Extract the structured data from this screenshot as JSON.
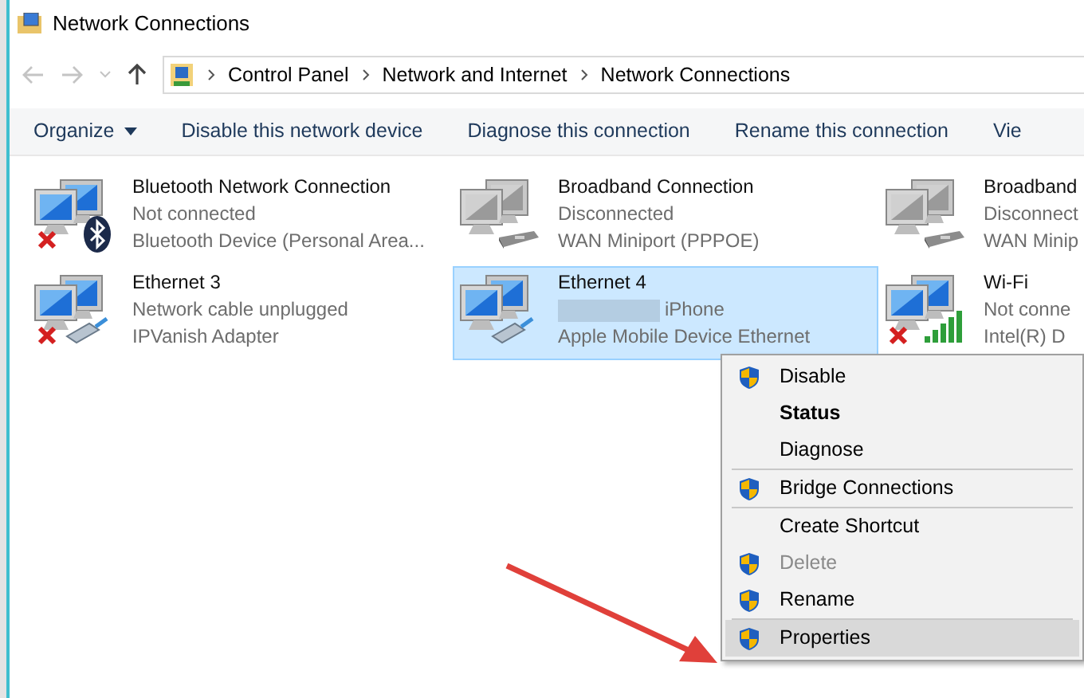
{
  "window": {
    "title": "Network Connections"
  },
  "breadcrumb": [
    "Control Panel",
    "Network and Internet",
    "Network Connections"
  ],
  "toolbar": [
    {
      "label": "Organize",
      "dropdown": true
    },
    {
      "label": "Disable this network device",
      "dropdown": false
    },
    {
      "label": "Diagnose this connection",
      "dropdown": false
    },
    {
      "label": "Rename this connection",
      "dropdown": false
    },
    {
      "label": "Vie",
      "dropdown": false
    }
  ],
  "connections": [
    {
      "name": "Bluetooth Network Connection",
      "status": "Not connected",
      "device": "Bluetooth Device (Personal Area...",
      "kind": "bluetooth",
      "error": true,
      "enabled": true,
      "selected": false,
      "redacted": false
    },
    {
      "name": "Broadband Connection",
      "status": "Disconnected",
      "device": "WAN Miniport (PPPOE)",
      "kind": "modem",
      "error": false,
      "enabled": false,
      "selected": false,
      "redacted": false
    },
    {
      "name": "Broadband",
      "status": "Disconnect",
      "device": "WAN Minip",
      "kind": "modem",
      "error": false,
      "enabled": false,
      "selected": false,
      "redacted": false
    },
    {
      "name": "Ethernet 3",
      "status": "Network cable unplugged",
      "device": "IPVanish Adapter",
      "kind": "cable",
      "error": true,
      "enabled": true,
      "selected": false,
      "redacted": false
    },
    {
      "name": "Ethernet 4",
      "status": "iPhone",
      "device": "Apple Mobile Device Ethernet",
      "kind": "cable",
      "error": false,
      "enabled": true,
      "selected": true,
      "redacted": true
    },
    {
      "name": "Wi-Fi",
      "status": "Not conne",
      "device": "Intel(R) D",
      "kind": "wireless",
      "error": true,
      "enabled": true,
      "selected": false,
      "redacted": false
    }
  ],
  "context_menu": {
    "groups": [
      [
        {
          "label": "Disable",
          "shield": true,
          "bold": false,
          "disabled": false,
          "selected": false
        },
        {
          "label": "Status",
          "shield": false,
          "bold": true,
          "disabled": false,
          "selected": false
        },
        {
          "label": "Diagnose",
          "shield": false,
          "bold": false,
          "disabled": false,
          "selected": false
        }
      ],
      [
        {
          "label": "Bridge Connections",
          "shield": true,
          "bold": false,
          "disabled": false,
          "selected": false
        }
      ],
      [
        {
          "label": "Create Shortcut",
          "shield": false,
          "bold": false,
          "disabled": false,
          "selected": false
        },
        {
          "label": "Delete",
          "shield": true,
          "bold": false,
          "disabled": true,
          "selected": false
        },
        {
          "label": "Rename",
          "shield": true,
          "bold": false,
          "disabled": false,
          "selected": false
        }
      ],
      [
        {
          "label": "Properties",
          "shield": true,
          "bold": false,
          "disabled": false,
          "selected": true
        }
      ]
    ]
  }
}
